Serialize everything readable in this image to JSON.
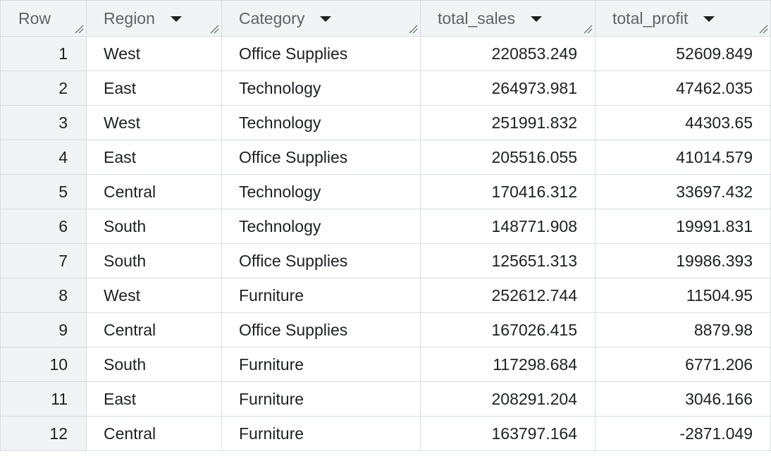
{
  "columns": [
    {
      "label": "Row"
    },
    {
      "label": "Region"
    },
    {
      "label": "Category"
    },
    {
      "label": "total_sales"
    },
    {
      "label": "total_profit"
    }
  ],
  "rows": [
    {
      "row": "1",
      "region": "West",
      "category": "Office Supplies",
      "total_sales": "220853.249",
      "total_profit": "52609.849"
    },
    {
      "row": "2",
      "region": "East",
      "category": "Technology",
      "total_sales": "264973.981",
      "total_profit": "47462.035"
    },
    {
      "row": "3",
      "region": "West",
      "category": "Technology",
      "total_sales": "251991.832",
      "total_profit": "44303.65"
    },
    {
      "row": "4",
      "region": "East",
      "category": "Office Supplies",
      "total_sales": "205516.055",
      "total_profit": "41014.579"
    },
    {
      "row": "5",
      "region": "Central",
      "category": "Technology",
      "total_sales": "170416.312",
      "total_profit": "33697.432"
    },
    {
      "row": "6",
      "region": "South",
      "category": "Technology",
      "total_sales": "148771.908",
      "total_profit": "19991.831"
    },
    {
      "row": "7",
      "region": "South",
      "category": "Office Supplies",
      "total_sales": "125651.313",
      "total_profit": "19986.393"
    },
    {
      "row": "8",
      "region": "West",
      "category": "Furniture",
      "total_sales": "252612.744",
      "total_profit": "11504.95"
    },
    {
      "row": "9",
      "region": "Central",
      "category": "Office Supplies",
      "total_sales": "167026.415",
      "total_profit": "8879.98"
    },
    {
      "row": "10",
      "region": "South",
      "category": "Furniture",
      "total_sales": "117298.684",
      "total_profit": "6771.206"
    },
    {
      "row": "11",
      "region": "East",
      "category": "Furniture",
      "total_sales": "208291.204",
      "total_profit": "3046.166"
    },
    {
      "row": "12",
      "region": "Central",
      "category": "Furniture",
      "total_sales": "163797.164",
      "total_profit": "-2871.049"
    }
  ],
  "icons": {
    "sort": "sort-dropdown-triangle",
    "resize": "column-resize-handle"
  },
  "colors": {
    "header_bg": "#f1f3f4",
    "grid_line": "#dadce0",
    "header_text": "#5f6368",
    "cell_text": "#202124"
  }
}
